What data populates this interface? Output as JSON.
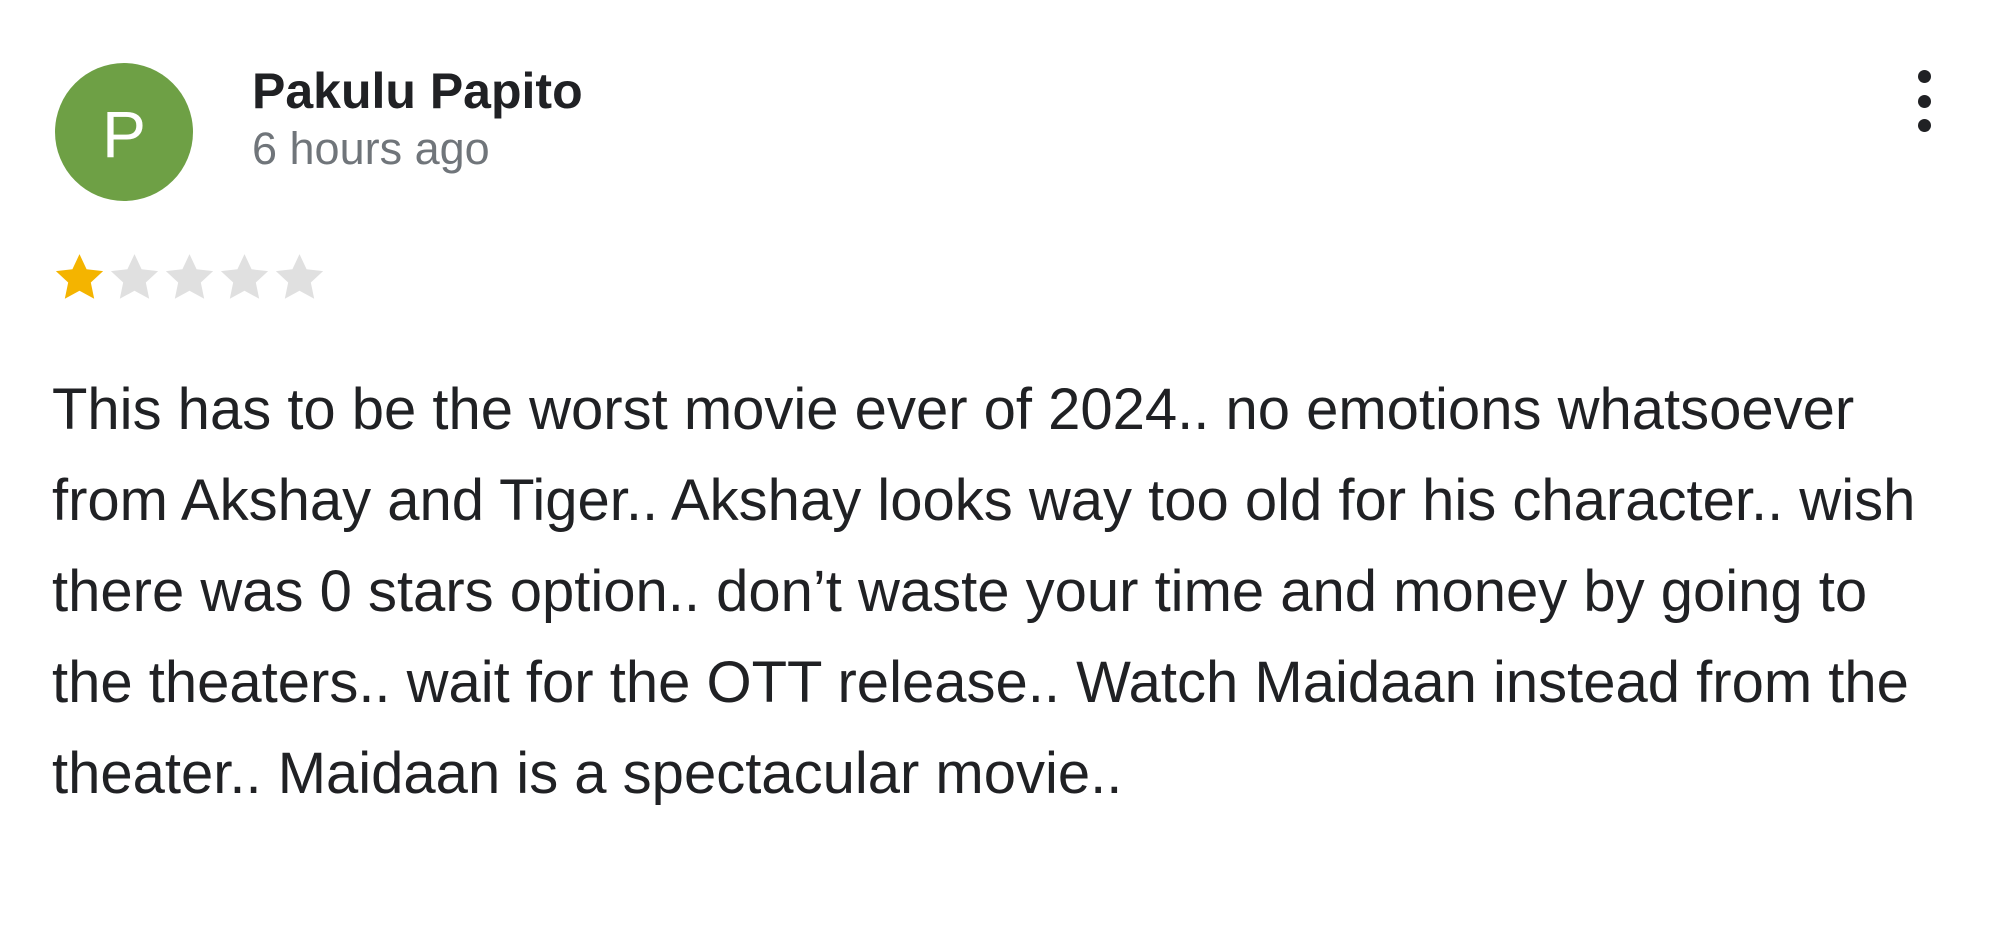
{
  "review": {
    "avatar_letter": "P",
    "avatar_color": "#6ea045",
    "reviewer_name": "Pakulu Papito",
    "time_ago": "6 hours ago",
    "rating": 1,
    "rating_max": 5,
    "star_filled_color": "#f4b400",
    "star_empty_color": "#e0e0e0",
    "text": "This has to be the worst movie ever of 2024.. no emotions whatsoever from Akshay and Tiger.. Akshay looks way too old for his character.. wish there was 0 stars option.. don’t waste your time and money by going to the theaters.. wait for the OTT release.. Watch Maidaan instead from the theater.. Maidaan is a spectacular movie..",
    "more_icon": "more-vert-icon"
  }
}
